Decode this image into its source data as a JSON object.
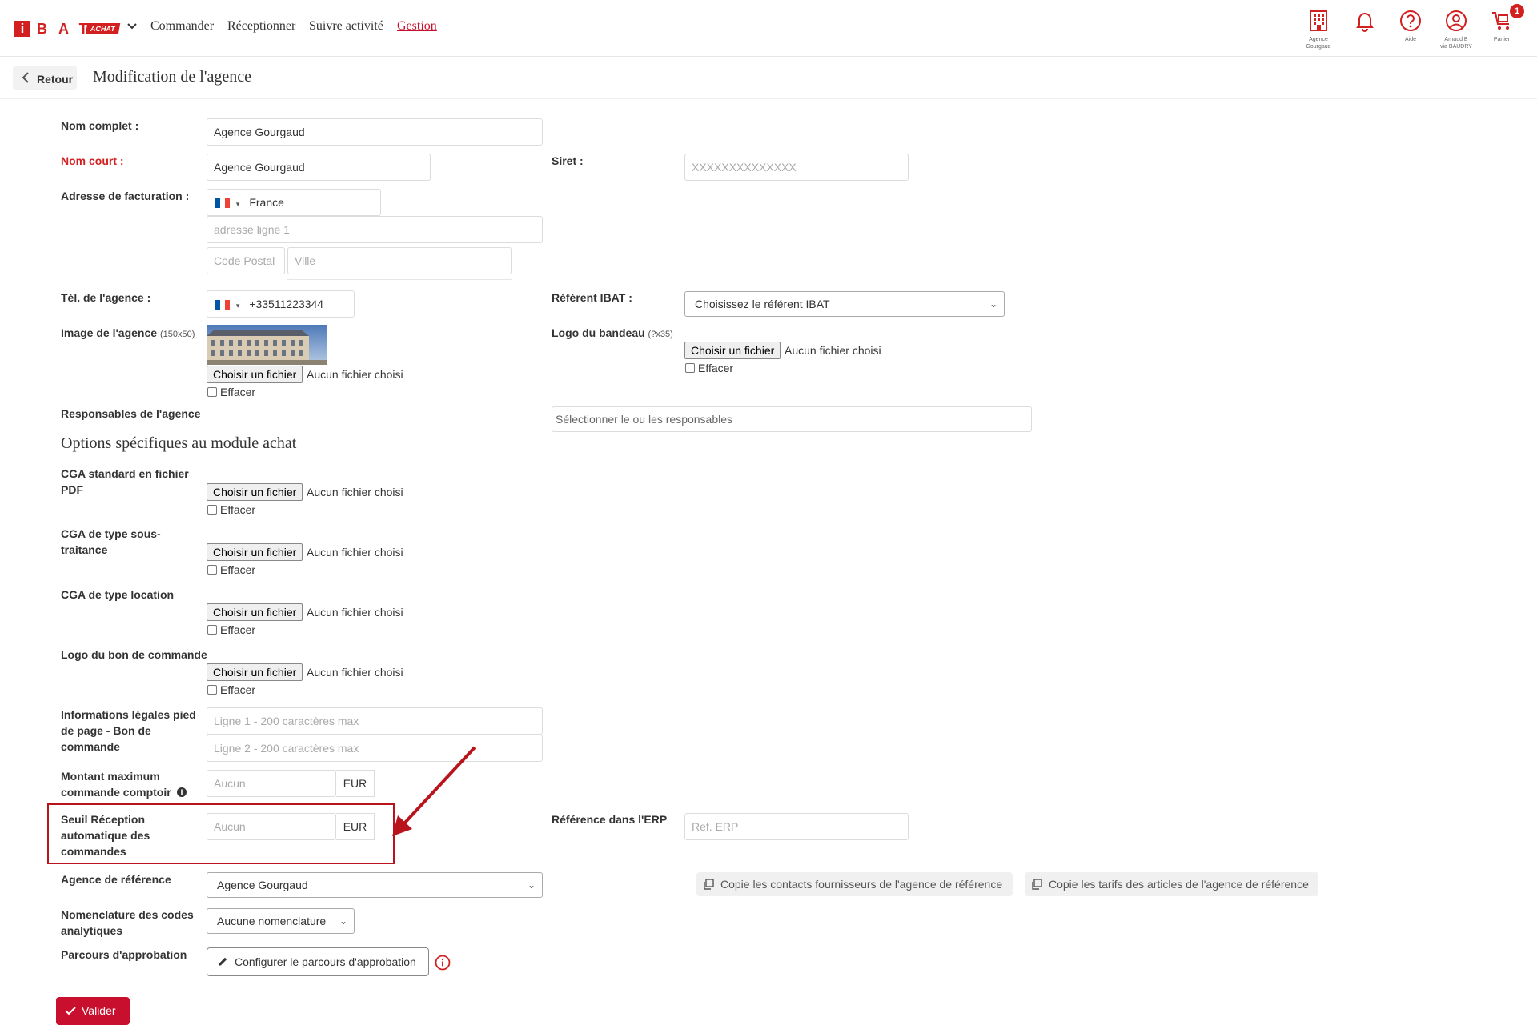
{
  "header": {
    "logo": {
      "mark": "i",
      "letters": "BAT",
      "badge": "ACHAT"
    },
    "nav": [
      "Commander",
      "Réceptionner",
      "Suivre activité",
      "Gestion"
    ],
    "active_nav": "Gestion",
    "icons": [
      {
        "name": "building-icon",
        "caption_1": "Agence",
        "caption_2": "Gourgaud"
      },
      {
        "name": "bell-icon",
        "caption_1": "",
        "caption_2": ""
      },
      {
        "name": "help-icon",
        "caption_1": "Aide",
        "caption_2": ""
      },
      {
        "name": "user-icon",
        "caption_1": "Arnaud B",
        "caption_2": "via BAUDRY"
      },
      {
        "name": "cart-icon",
        "caption_1": "Panier",
        "caption_2": ""
      }
    ],
    "cart_count": "1"
  },
  "subheader": {
    "back_label": "Retour",
    "title": "Modification de l'agence"
  },
  "form": {
    "nom_complet": {
      "label": "Nom complet :",
      "value": "Agence Gourgaud"
    },
    "nom_court": {
      "label": "Nom court :",
      "value": "Agence Gourgaud"
    },
    "siret": {
      "label": "Siret :",
      "placeholder": "XXXXXXXXXXXXXX"
    },
    "adresse": {
      "label": "Adresse de facturation :",
      "country": "France",
      "line1_placeholder": "adresse ligne 1",
      "cp_placeholder": "Code Postal",
      "ville_placeholder": "Ville"
    },
    "tel": {
      "label": "Tél. de l'agence :",
      "value": "+33511223344"
    },
    "referent": {
      "label": "Référent IBAT :",
      "value": "Choisissez le référent IBAT"
    },
    "image": {
      "label": "Image de l'agence",
      "hint": "(150x50)"
    },
    "logo_bandeau": {
      "label": "Logo du bandeau",
      "hint": "(?x35)"
    },
    "file_button": "Choisir un fichier",
    "file_none": "Aucun fichier choisi",
    "effacer": "Effacer",
    "responsables": {
      "label": "Responsables de l'agence",
      "placeholder": "Sélectionner le ou les responsables"
    },
    "section_title": "Options spécifiques au module achat",
    "cga_pdf": {
      "label_1": "CGA standard en fichier",
      "label_2": "PDF"
    },
    "cga_sous": {
      "label_1": "CGA de type sous-",
      "label_2": "traitance"
    },
    "cga_location": {
      "label": "CGA de type location"
    },
    "logo_bon": {
      "label": "Logo du bon de commande"
    },
    "infos_legales": {
      "label_1": "Informations légales pied",
      "label_2": "de page - Bon de",
      "label_3": "commande",
      "line1_placeholder": "Ligne 1 - 200 caractères max",
      "line2_placeholder": "Ligne 2 - 200 caractères max"
    },
    "montant_max": {
      "label_1": "Montant maximum",
      "label_2": "commande comptoir",
      "placeholder": "Aucun",
      "unit": "EUR"
    },
    "seuil": {
      "label_1": "Seuil Réception",
      "label_2": "automatique des",
      "label_3": "commandes",
      "placeholder": "Aucun",
      "unit": "EUR"
    },
    "ref_erp": {
      "label": "Référence dans l'ERP",
      "placeholder": "Ref. ERP"
    },
    "agence_ref": {
      "label": "Agence de référence",
      "value": "Agence Gourgaud"
    },
    "copy_contacts": "Copie les contacts fournisseurs de l'agence de référence",
    "copy_tarifs": "Copie les tarifs des articles de l'agence de référence",
    "nomenclature": {
      "label_1": "Nomenclature des codes",
      "label_2": "analytiques",
      "value": "Aucune nomenclature"
    },
    "parcours": {
      "label": "Parcours d'approbation",
      "button": "Configurer le parcours d'approbation"
    },
    "submit": "Valider"
  },
  "colors": {
    "brand_red": "#d21f1f",
    "highlight_red": "#b9141b"
  }
}
